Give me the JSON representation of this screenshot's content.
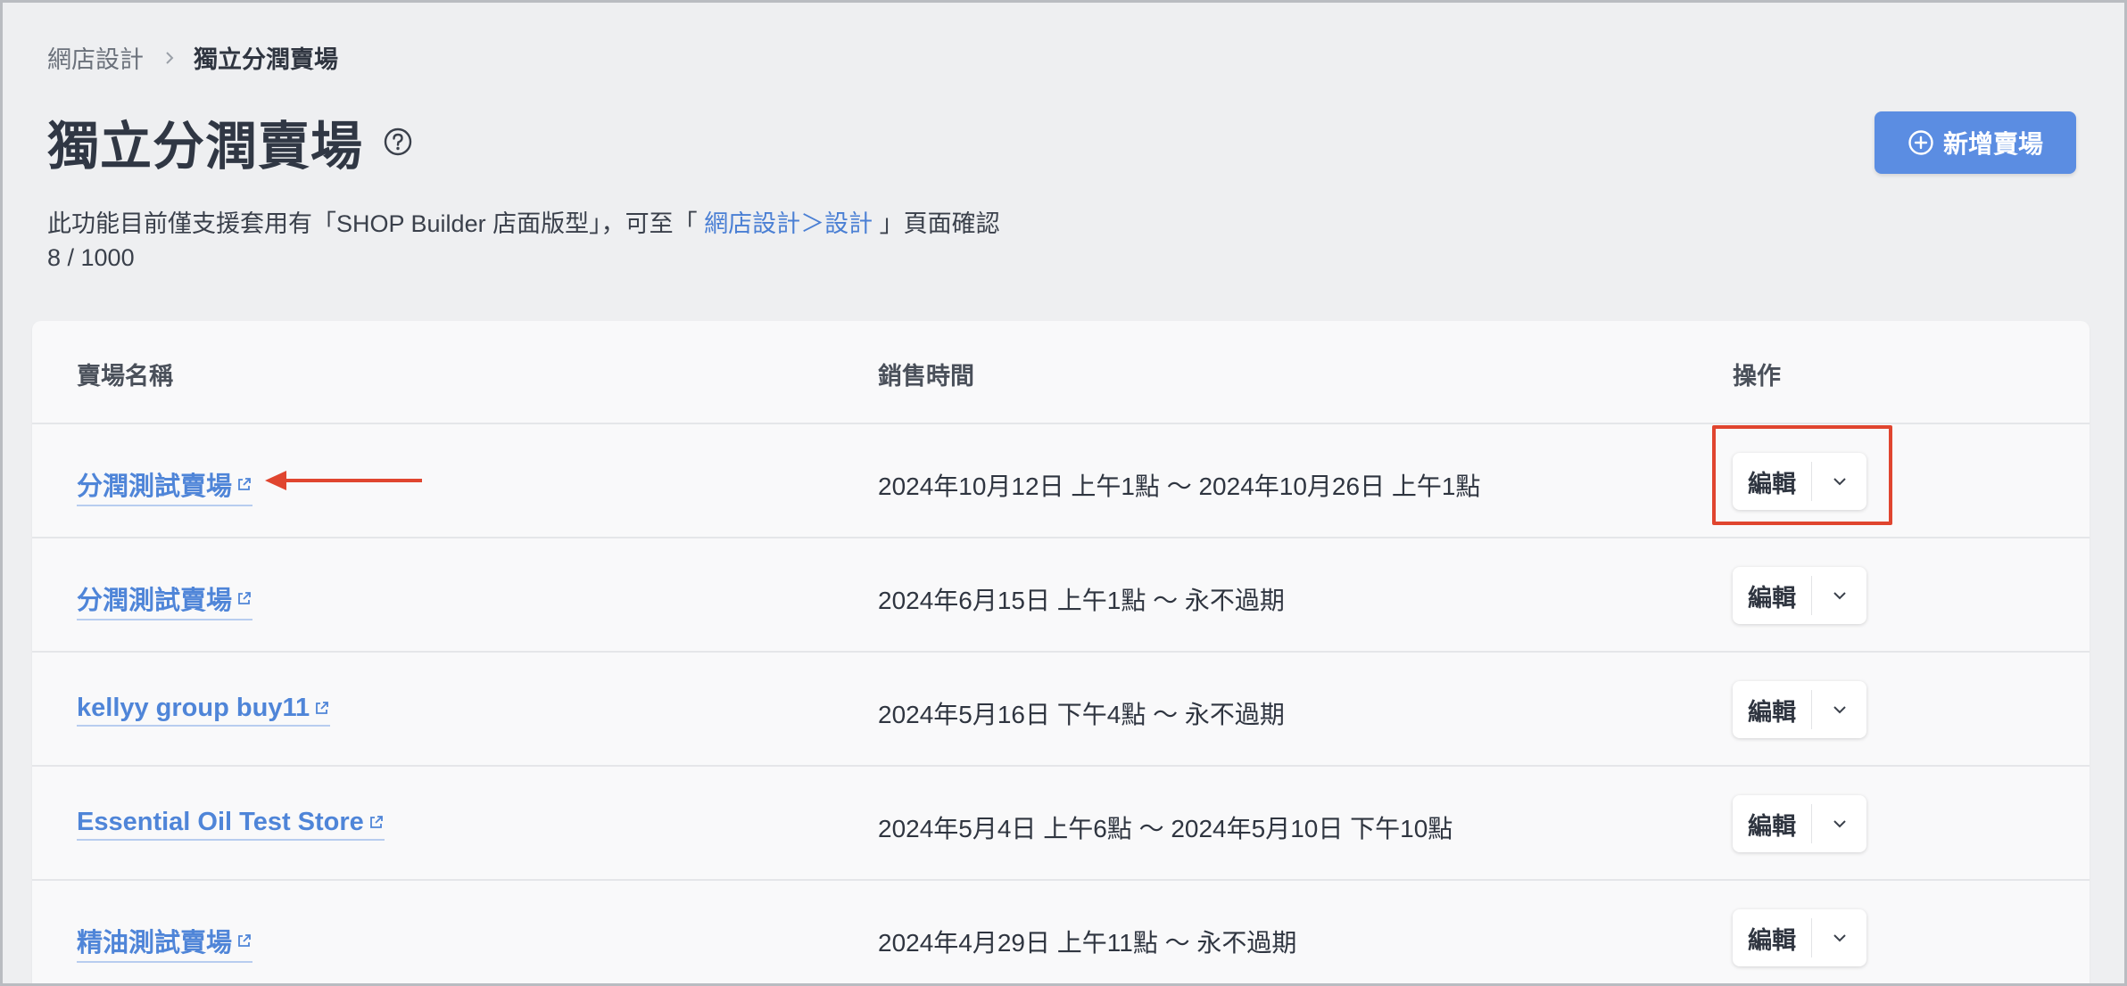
{
  "breadcrumb": {
    "parent": "網店設計",
    "current": "獨立分潤賣場"
  },
  "header": {
    "title": "獨立分潤賣場",
    "add_button_label": "新增賣場"
  },
  "notice": {
    "prefix": "此功能目前僅支援套用有「SHOP Builder 店面版型」，可至「 ",
    "link": "網店設計＞設計",
    "suffix": " 」頁面確認"
  },
  "count": "8 / 1000",
  "table": {
    "headers": {
      "name": "賣場名稱",
      "time": "銷售時間",
      "actions": "操作"
    },
    "edit_label": "編輯",
    "rows": [
      {
        "name": "分潤測試賣場",
        "time": "2024年10月12日 上午1點 ～ 2024年10月26日 上午1點"
      },
      {
        "name": "分潤測試賣場",
        "time": "2024年6月15日 上午1點 ～ 永不過期"
      },
      {
        "name": "kellyy group buy11",
        "time": "2024年5月16日 下午4點 ～ 永不過期"
      },
      {
        "name": "Essential Oil Test Store",
        "time": "2024年5月4日 上午6點 ～ 2024年5月10日 下午10點"
      },
      {
        "name": "精油測試賣場",
        "time": "2024年4月29日 上午11點 ～ 永不過期"
      }
    ]
  },
  "colors": {
    "accent": "#5b8de2",
    "link": "#4f85d8",
    "annotation": "#e0452f"
  },
  "icons": [
    "chevron-right-icon",
    "help-circle-icon",
    "plus-circle-icon",
    "external-link-icon",
    "chevron-down-icon"
  ]
}
